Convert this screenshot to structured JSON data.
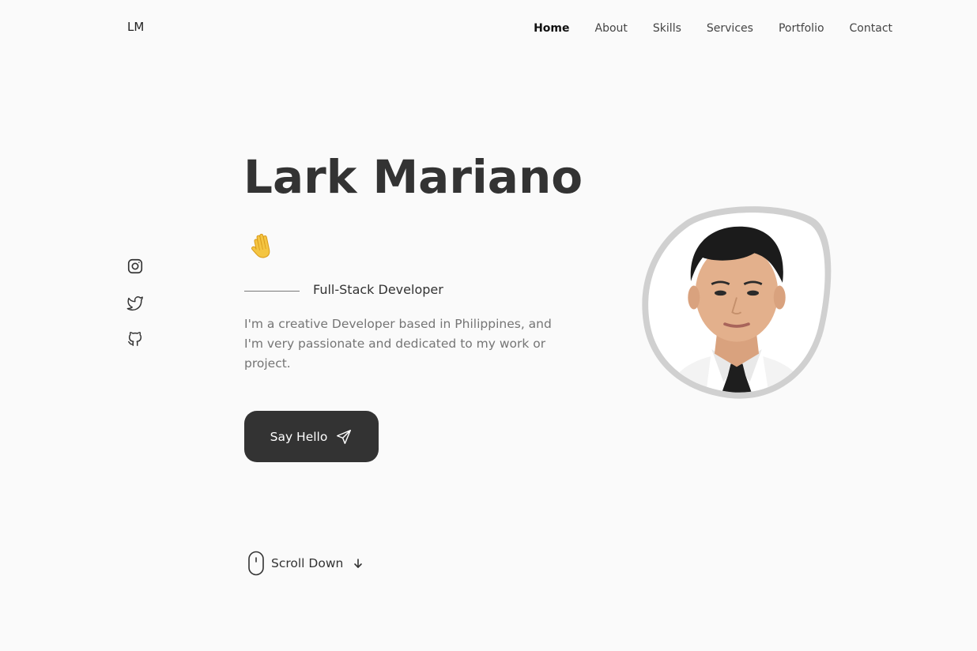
{
  "header": {
    "logo": "LM",
    "nav": [
      {
        "label": "Home",
        "active": true
      },
      {
        "label": "About",
        "active": false
      },
      {
        "label": "Skills",
        "active": false
      },
      {
        "label": "Services",
        "active": false
      },
      {
        "label": "Portfolio",
        "active": false
      },
      {
        "label": "Contact",
        "active": false
      }
    ]
  },
  "social": [
    "instagram-icon",
    "twitter-icon",
    "github-icon"
  ],
  "hero": {
    "name": "Lark Mariano",
    "wave_emoji": "🖐",
    "subtitle": "Full-Stack Developer",
    "description": "I'm a creative Developer based in Philippines, and I'm very passionate and dedicated to my work or project.",
    "cta_label": "Say Hello",
    "scroll_label": "Scroll Down"
  },
  "colors": {
    "background": "#fafafa",
    "text": "#333333",
    "muted": "#757575",
    "button": "#333333",
    "button_text": "#ffffff",
    "blob_border": "#d0d0d0"
  }
}
